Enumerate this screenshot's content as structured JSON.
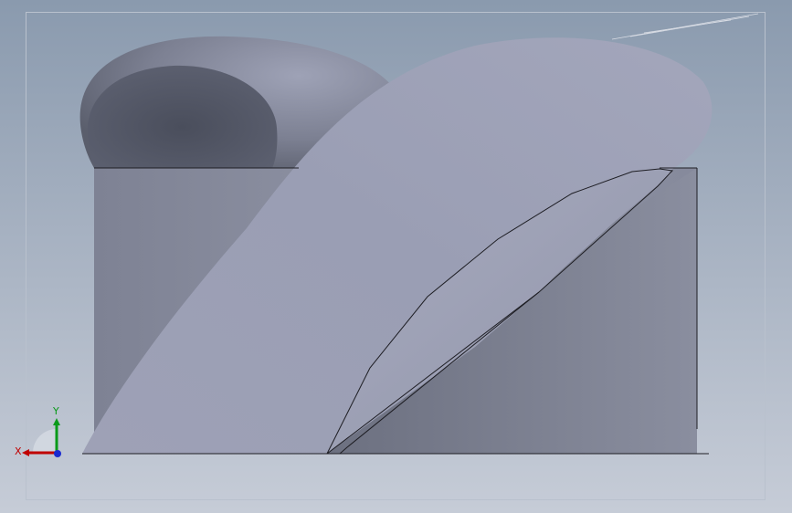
{
  "viewport": {
    "background_top": "#8a9aae",
    "background_bottom": "#c6ccd7"
  },
  "model": {
    "base_block_color": "#8a8e9e",
    "surface_color": "#9a9eb4",
    "shadow_color": "#555968",
    "edge_color": "#1e1e24"
  },
  "triad": {
    "x_label": "X",
    "y_label": "Y",
    "x_color": "#c00000",
    "y_color": "#0a9a1a",
    "z_color": "#1a2ad0"
  }
}
